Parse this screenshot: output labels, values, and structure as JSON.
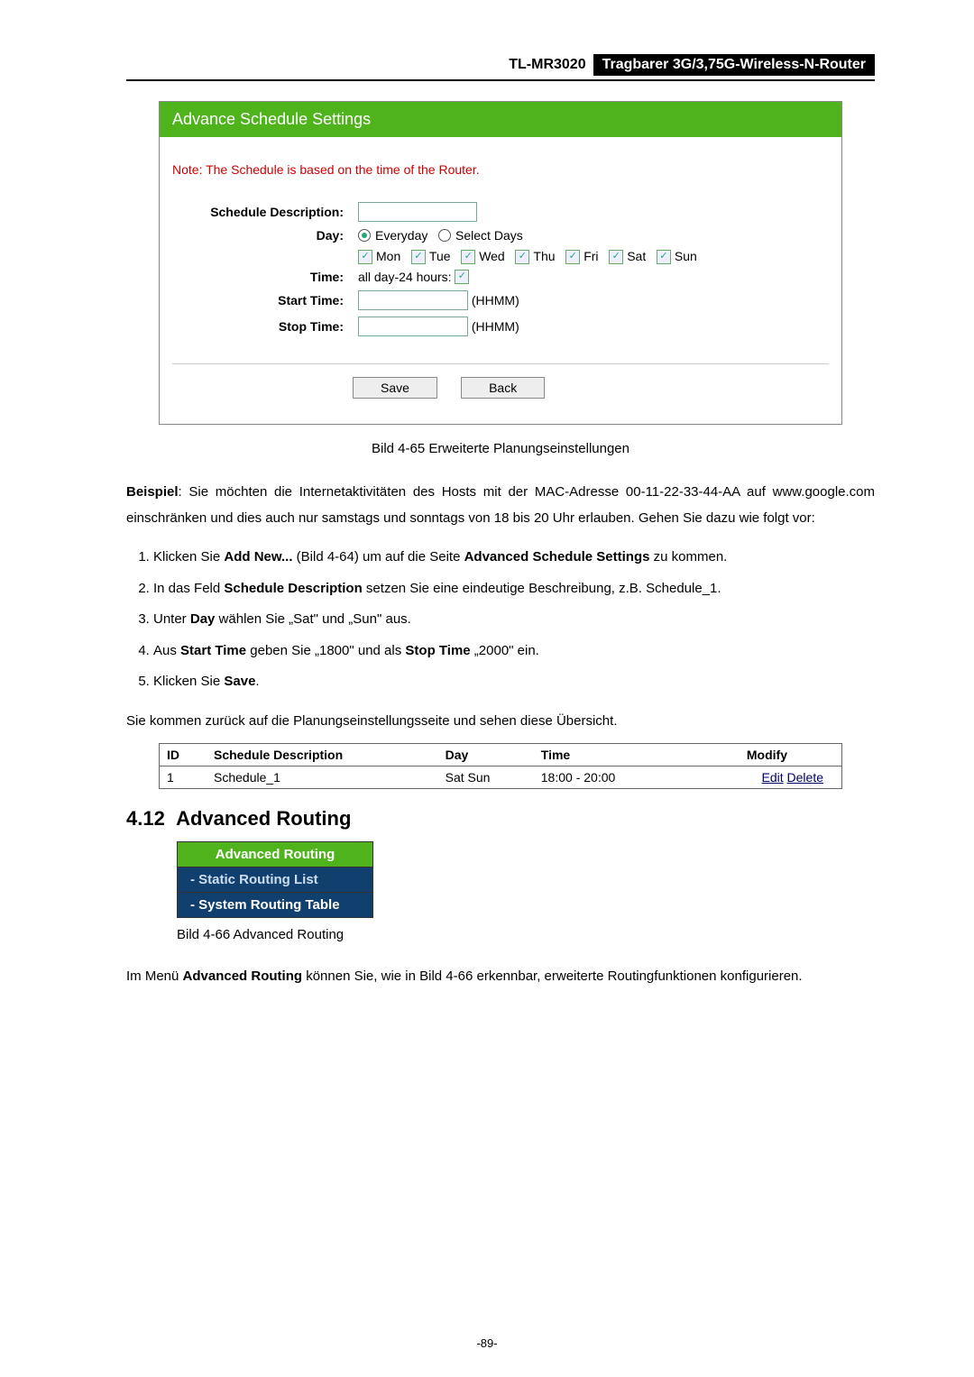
{
  "header": {
    "model": "TL-MR3020",
    "subtitle": "Tragbarer 3G/3,75G-Wireless-N-Router"
  },
  "panel": {
    "title": "Advance Schedule Settings",
    "note": "Note: The Schedule is based on the time of the Router.",
    "labels": {
      "desc": "Schedule Description:",
      "day": "Day:",
      "time": "Time:",
      "start": "Start Time:",
      "stop": "Stop Time:"
    },
    "day_opts": {
      "everyday": "Everyday",
      "select": "Select Days"
    },
    "days": [
      "Mon",
      "Tue",
      "Wed",
      "Thu",
      "Fri",
      "Sat",
      "Sun"
    ],
    "time_allday": "all day-24 hours:",
    "hint": "(HHMM)",
    "buttons": {
      "save": "Save",
      "back": "Back"
    }
  },
  "caption1": "Bild 4-65 Erweiterte Planungseinstellungen",
  "example": {
    "lead": "Beispiel",
    "text": ": Sie möchten die Internetaktivitäten des Hosts mit der MAC-Adresse 00-11-22-33-44-AA auf www.google.com einschränken und dies auch nur samstags und sonntags von 18 bis 20 Uhr erlauben. Gehen Sie dazu wie folgt vor:"
  },
  "steps": {
    "s1a": "Klicken Sie ",
    "s1b": "Add New...",
    "s1c": " (Bild 4-64) um auf die Seite ",
    "s1d": "Advanced Schedule Settings",
    "s1e": " zu kommen.",
    "s2a": "In das Feld ",
    "s2b": "Schedule Description",
    "s2c": " setzen Sie eine eindeutige Beschreibung, z.B. Schedule_1.",
    "s3a": "Unter ",
    "s3b": "Day",
    "s3c": " wählen Sie „Sat\" und „Sun\" aus.",
    "s4a": "Aus ",
    "s4b": "Start Time",
    "s4c": " geben Sie „1800\" und als ",
    "s4d": "Stop Time",
    "s4e": " „2000\" ein.",
    "s5a": "Klicken Sie ",
    "s5b": "Save",
    "s5c": "."
  },
  "afterlist": "Sie kommen zurück auf die Planungseinstellungsseite und sehen diese Übersicht.",
  "table": {
    "headers": {
      "id": "ID",
      "desc": "Schedule Description",
      "day": "Day",
      "time": "Time",
      "modify": "Modify"
    },
    "row": {
      "id": "1",
      "desc": "Schedule_1",
      "day": "Sat Sun",
      "time": "18:00 - 20:00",
      "edit": "Edit",
      "delete": "Delete"
    }
  },
  "section": {
    "num": "4.12",
    "title": "Advanced Routing"
  },
  "menu": {
    "head": "Advanced Routing",
    "items": [
      "- Static Routing List",
      "- System Routing Table"
    ]
  },
  "caption2": "Bild 4-66 Advanced Routing",
  "para2a": "Im Menü ",
  "para2b": "Advanced Routing",
  "para2c": " können Sie, wie in Bild 4-66 erkennbar, erweiterte Routingfunktionen konfigurieren.",
  "pagenum": "-89-"
}
